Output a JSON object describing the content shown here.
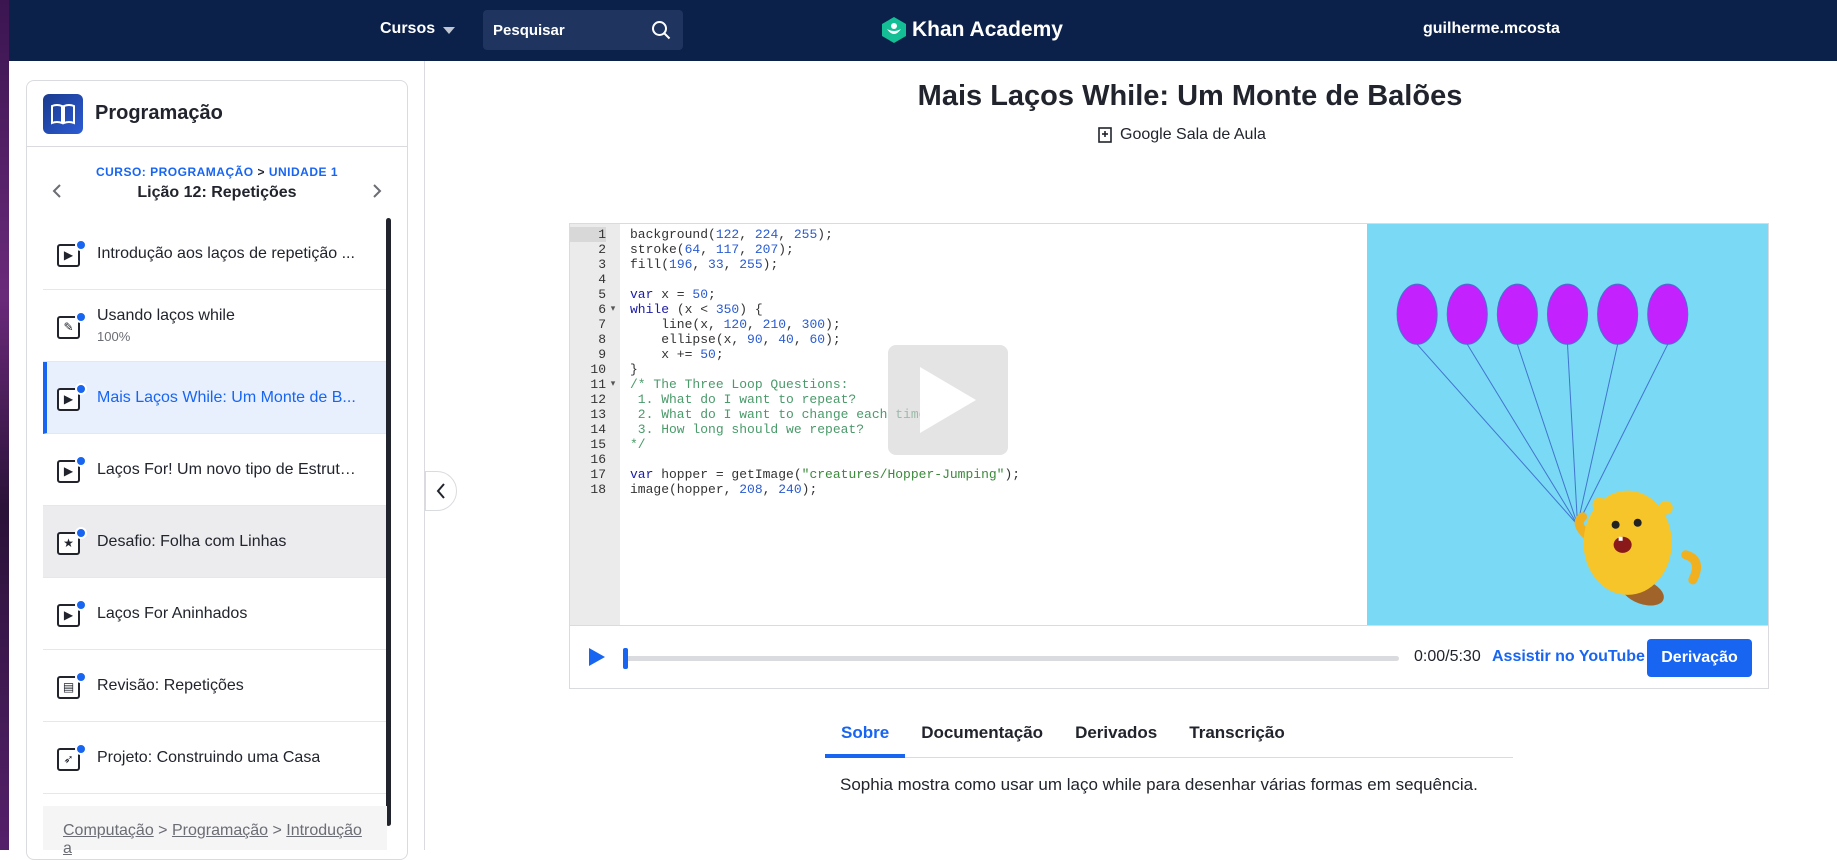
{
  "topbar": {
    "courses_label": "Cursos",
    "search_placeholder": "Pesquisar",
    "brand": "Khan Academy",
    "username": "guilherme.mcosta",
    "colors": {
      "bar": "#0b2149",
      "accent": "#1865f2"
    }
  },
  "sidebar": {
    "course_title": "Programação",
    "crumb_course": "CURSO: PROGRAMAÇÃO",
    "crumb_sep": ">",
    "crumb_unit": "UNIDADE 1",
    "lesson_title": "Lição 12: Repetições",
    "items": [
      {
        "label": "Introdução aos laços de repetição ...",
        "icon": "video-icon",
        "sub": ""
      },
      {
        "label": "Usando laços while",
        "icon": "pencil-icon",
        "sub": "100%"
      },
      {
        "label": "Mais Laços While: Um Monte de B...",
        "icon": "video-icon",
        "sub": ""
      },
      {
        "label": "Laços For! Um novo tipo de Estrutu...",
        "icon": "video-icon",
        "sub": ""
      },
      {
        "label": "Desafio: Folha com Linhas",
        "icon": "star-icon",
        "sub": ""
      },
      {
        "label": "Laços For Aninhados",
        "icon": "video-icon",
        "sub": ""
      },
      {
        "label": "Revisão: Repetições",
        "icon": "document-icon",
        "sub": ""
      },
      {
        "label": "Projeto: Construindo uma Casa",
        "icon": "rocket-icon",
        "sub": ""
      }
    ],
    "footer": {
      "crumb1": "Computação",
      "crumb2": "Programação",
      "crumb3": "Introdução a",
      "sep": ">"
    }
  },
  "main": {
    "title": "Mais Laços While: Um Monte de Balões",
    "google_classroom": "Google Sala de Aula",
    "code_lines": [
      "background(122, 224, 255);",
      "stroke(64, 117, 207);",
      "fill(196, 33, 255);",
      "",
      "var x = 50;",
      "while (x < 350) {",
      "    line(x, 120, 210, 300);",
      "    ellipse(x, 90, 40, 60);",
      "    x += 50;",
      "}",
      "/* The Three Loop Questions:",
      " 1. What do I want to repeat?",
      " 2. What do I want to change each time?",
      " 3. How long should we repeat?",
      "*/",
      "",
      "var hopper = getImage(\"creatures/Hopper-Jumping\");",
      "image(hopper, 208, 240);"
    ],
    "time": "0:00/5:30",
    "progress": 0,
    "youtube_label": "Assistir no YouTube",
    "derivation_label": "Derivação",
    "tabs": [
      "Sobre",
      "Documentação",
      "Derivados",
      "Transcrição"
    ],
    "about_text": "Sophia mostra como usar um laço while para desenhar várias formas em sequência.",
    "canvas_colors": {
      "background": "#7ad9f5",
      "balloon": "#c421ff",
      "string": "#4075cf"
    }
  }
}
